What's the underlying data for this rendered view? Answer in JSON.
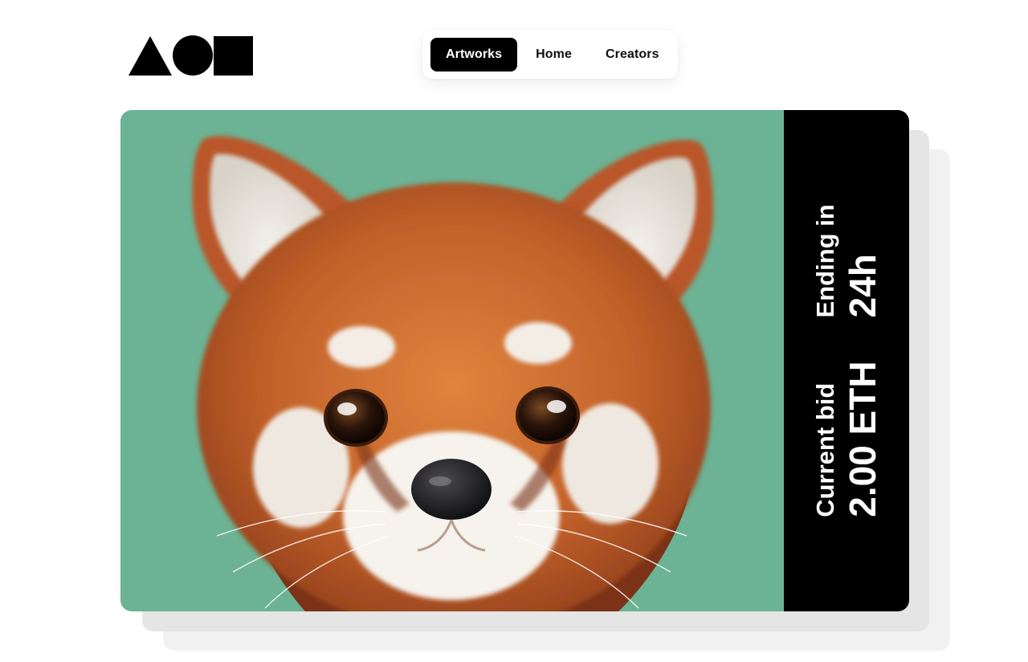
{
  "logo": {
    "icon": "shapes-logo-icon",
    "color": "#000000"
  },
  "nav": {
    "items": [
      {
        "label": "Artworks",
        "active": true
      },
      {
        "label": "Home",
        "active": false
      },
      {
        "label": "Creators",
        "active": false
      }
    ]
  },
  "artwork": {
    "subject": "red-panda-image",
    "background_color": "#6cb294"
  },
  "auction": {
    "current_bid_label": "Current bid",
    "current_bid_value": "2.00 ETH",
    "ending_label": "Ending in",
    "ending_value": "24h"
  }
}
